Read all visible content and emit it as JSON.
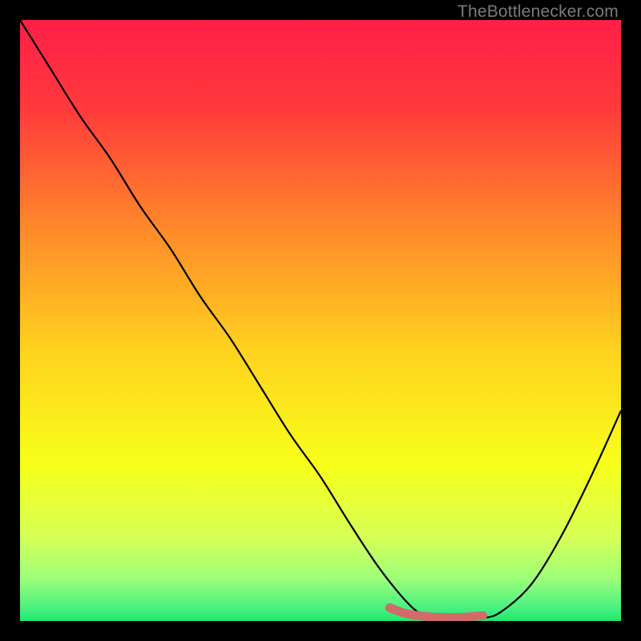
{
  "watermark": "TheBottlenecker.com",
  "chart_data": {
    "type": "line",
    "title": "",
    "xlabel": "",
    "ylabel": "",
    "xlim": [
      0,
      1
    ],
    "ylim": [
      0,
      1
    ],
    "gradient_stops": [
      {
        "offset": 0.0,
        "color": "#ff1e49"
      },
      {
        "offset": 0.15,
        "color": "#ff3b3b"
      },
      {
        "offset": 0.35,
        "color": "#ff8a2a"
      },
      {
        "offset": 0.55,
        "color": "#ffd21f"
      },
      {
        "offset": 0.74,
        "color": "#f7ff1a"
      },
      {
        "offset": 0.86,
        "color": "#d7ff55"
      },
      {
        "offset": 0.93,
        "color": "#9cff7a"
      },
      {
        "offset": 0.98,
        "color": "#45f07f"
      },
      {
        "offset": 1.0,
        "color": "#1ee86e"
      }
    ],
    "series": [
      {
        "name": "bottleneck-curve",
        "color": "#000000",
        "width": 2.2,
        "x": [
          0.0,
          0.05,
          0.1,
          0.15,
          0.2,
          0.25,
          0.3,
          0.35,
          0.4,
          0.45,
          0.5,
          0.55,
          0.6,
          0.65,
          0.675,
          0.7,
          0.73,
          0.77,
          0.8,
          0.85,
          0.9,
          0.95,
          1.0
        ],
        "y": [
          1.0,
          0.92,
          0.84,
          0.77,
          0.69,
          0.62,
          0.54,
          0.47,
          0.39,
          0.31,
          0.24,
          0.16,
          0.085,
          0.025,
          0.01,
          0.005,
          0.005,
          0.005,
          0.015,
          0.06,
          0.14,
          0.24,
          0.35
        ]
      },
      {
        "name": "optimal-band",
        "color": "#d36a6a",
        "width": 11,
        "linecap": "round",
        "x": [
          0.615,
          0.64,
          0.67,
          0.7,
          0.735,
          0.77
        ],
        "y": [
          0.022,
          0.013,
          0.008,
          0.006,
          0.006,
          0.009
        ]
      }
    ],
    "legend": [],
    "annotations": []
  }
}
